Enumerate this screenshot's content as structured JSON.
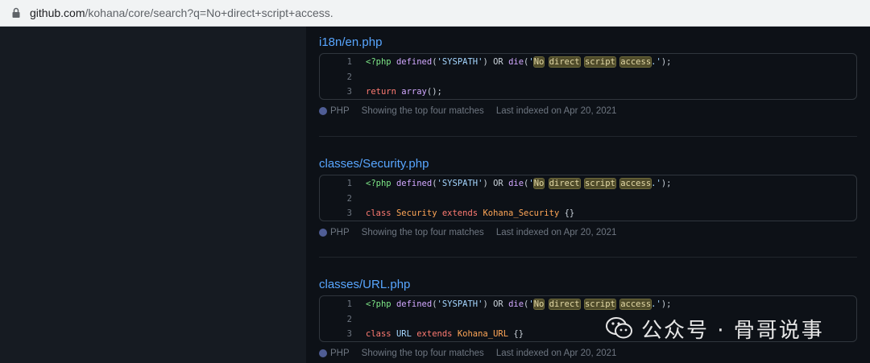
{
  "browser": {
    "url_host": "github.com",
    "url_path": "/kohana/core/search?q=No+direct+script+access."
  },
  "results": [
    {
      "title": "i18n/en.php",
      "lines": [
        {
          "num": "1",
          "kind": "defined"
        },
        {
          "num": "2",
          "kind": "blank"
        },
        {
          "num": "3",
          "kind": "return",
          "text": "return array();"
        }
      ],
      "language": "PHP",
      "matches": "Showing the top four matches",
      "indexed": "Last indexed on Apr 20, 2021"
    },
    {
      "title": "classes/Security.php",
      "lines": [
        {
          "num": "1",
          "kind": "defined"
        },
        {
          "num": "2",
          "kind": "blank"
        },
        {
          "num": "3",
          "kind": "class",
          "text": "class Security extends Kohana_Security {}"
        }
      ],
      "language": "PHP",
      "matches": "Showing the top four matches",
      "indexed": "Last indexed on Apr 20, 2021"
    },
    {
      "title": "classes/URL.php",
      "lines": [
        {
          "num": "1",
          "kind": "defined"
        },
        {
          "num": "2",
          "kind": "blank"
        },
        {
          "num": "3",
          "kind": "class",
          "text": "class URL extends Kohana_URL {}"
        }
      ],
      "language": "PHP",
      "matches": "Showing the top four matches",
      "indexed": "Last indexed on Apr 20, 2021"
    }
  ],
  "code_line1": {
    "open_tag": "<?php",
    "fn_defined": "defined",
    "arg": "'SYSPATH'",
    "or": "OR",
    "fn_die": "die",
    "q_open": "'",
    "w1": "No",
    "w2": "direct",
    "w3": "script",
    "w4": "access",
    "tail": ".'",
    "end": ");"
  },
  "code_line3": {
    "return_kw": "return",
    "array_fn": "array",
    "class_kw": "class",
    "extends_kw": "extends",
    "sec_name": "Security",
    "sec_parent": "Kohana_Security",
    "url_name": "URL",
    "url_parent": "Kohana_URL",
    "braces": "{}"
  },
  "colors": {
    "language_dot": "#4f5d95",
    "link": "#58a6ff",
    "highlight": "#4f4b2a"
  },
  "watermark": {
    "text": "公众号 · 骨哥说事",
    "icon": "wechat-icon"
  }
}
